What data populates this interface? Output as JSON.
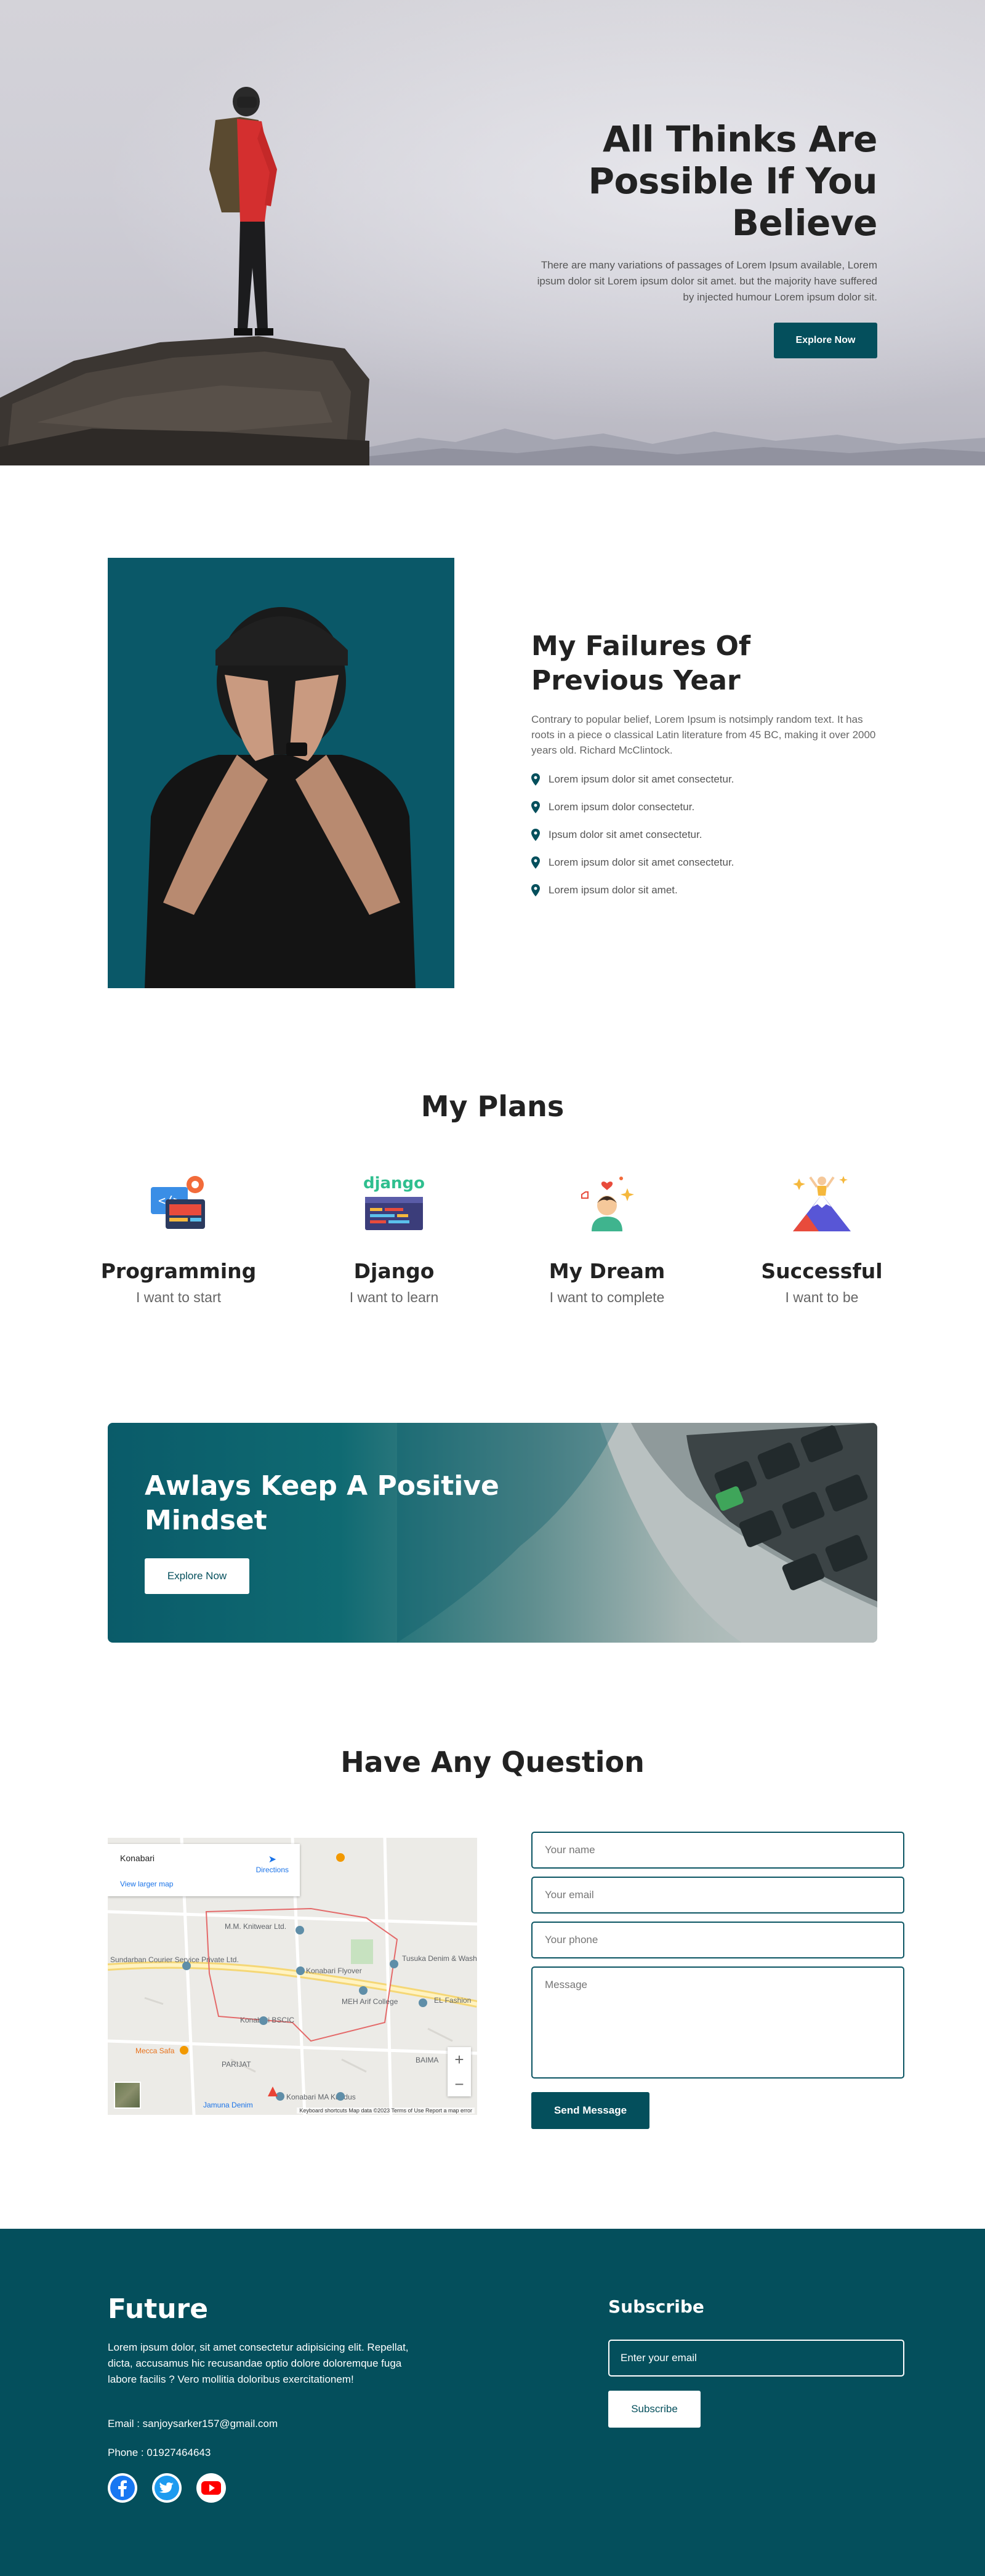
{
  "hero": {
    "title_line1": "All Thinks Are",
    "title_line2": "Possible If You",
    "title_line3": "Believe",
    "description": "There are many variations of passages of Lorem Ipsum available, Lorem ipsum dolor sit Lorem ipsum dolor sit amet. but the majority have suffered by injected humour Lorem ipsum dolor sit.",
    "button_label": "Explore Now"
  },
  "failures": {
    "title_line1": "My Failures Of",
    "title_line2": "Previous Year",
    "description": "Contrary to popular belief, Lorem Ipsum is notsimply random text. It has roots in a piece o classical Latin literature from 45 BC, making it over 2000 years old. Richard McClintock.",
    "items": [
      "Lorem ipsum dolor sit amet consectetur.",
      "Lorem ipsum dolor consectetur.",
      "Ipsum dolor sit amet consectetur.",
      "Lorem ipsum dolor sit amet consectetur.",
      "Lorem ipsum dolor sit amet."
    ]
  },
  "plans": {
    "title": "My Plans",
    "items": [
      {
        "name": "Programming",
        "sub": "I want to start",
        "icon": "code-window-icon"
      },
      {
        "name": "Django",
        "sub": "I want to learn",
        "icon": "django-icon",
        "logo_text": "django"
      },
      {
        "name": "My Dream",
        "sub": "I want to complete",
        "icon": "dream-person-icon"
      },
      {
        "name": "Successful",
        "sub": "I want to be",
        "icon": "mountain-summit-icon"
      }
    ]
  },
  "banner": {
    "title_line1": "Awlays Keep A Positive",
    "title_line2": "Mindset",
    "button_label": "Explore Now"
  },
  "question": {
    "title": "Have Any Question",
    "map": {
      "place": "Konabari",
      "directions": "Directions",
      "larger_map": "View larger map",
      "labels": [
        "M.M. Knitwear Ltd.",
        "Sundarban Courier Service Private Ltd.",
        "Konabari Flyover",
        "Tusuka Denim & Washing Ltd",
        "MEH Arif College",
        "Konabari BSCIC",
        "EL Fashion",
        "Mecca Safa",
        "PARIJAT",
        "BAIMA",
        "Jamuna Denim",
        "Konabari MA Kuddus"
      ],
      "attribution": "Keyboard shortcuts   Map data ©2023   Terms of Use   Report a map error"
    },
    "form": {
      "name_placeholder": "Your name",
      "email_placeholder": "Your email",
      "phone_placeholder": "Your phone",
      "message_placeholder": "Message",
      "send_label": "Send Message"
    }
  },
  "footer": {
    "brand": "Future",
    "description": "Lorem ipsum dolor, sit amet consectetur adipisicing elit. Repellat, dicta, accusamus hic recusandae optio dolore doloremque fuga labore facilis ? Vero mollitia doloribus exercitationem!",
    "email": "Email : sanjoysarker157@gmail.com",
    "phone": "Phone : 01927464643",
    "social": [
      "facebook-icon",
      "twitter-icon",
      "youtube-icon"
    ],
    "subscribe_title": "Subscribe",
    "subscribe_placeholder": "Enter your email",
    "subscribe_button": "Subscribe"
  },
  "colors": {
    "primary": "#044f5c",
    "text_dark": "#222222",
    "text_muted": "#666666"
  }
}
